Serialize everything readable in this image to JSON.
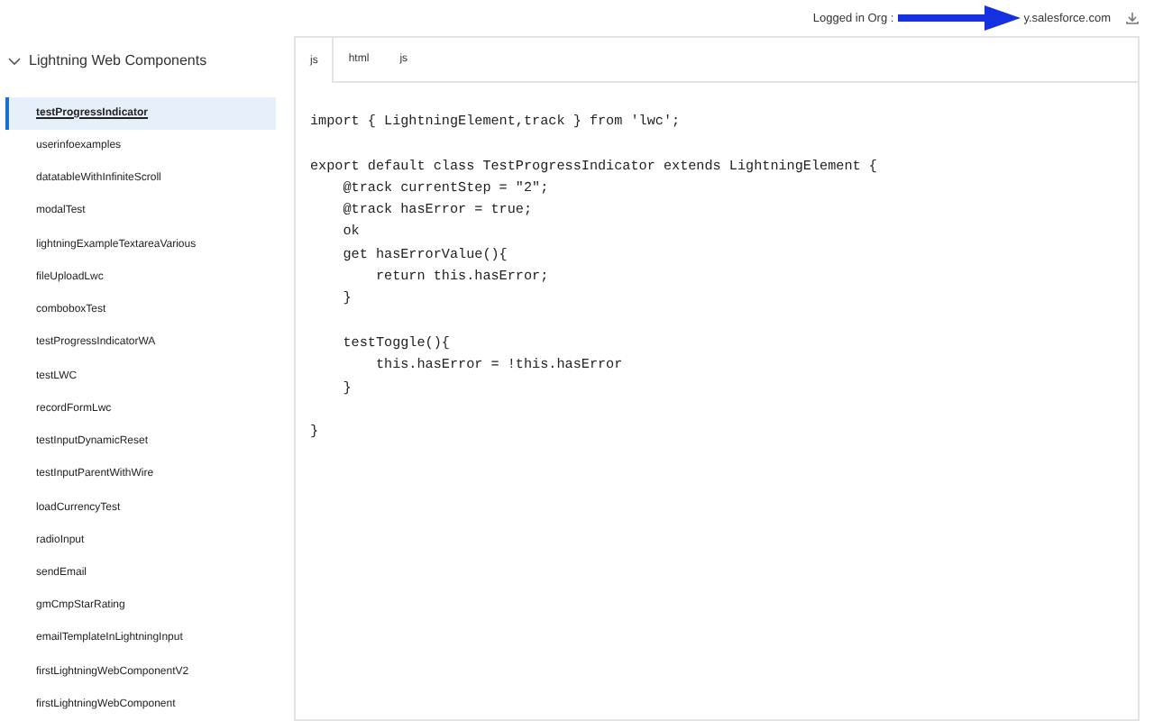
{
  "header": {
    "org_label": "Logged in Org :",
    "org_suffix": "y.salesforce.com"
  },
  "sidebar": {
    "title": "Lightning Web Components",
    "expanded": true,
    "items": [
      {
        "label": "testProgressIndicator",
        "selected": true
      },
      {
        "label": "userinfoexamples",
        "selected": false
      },
      {
        "label": "datatableWithInfiniteScroll",
        "selected": false
      },
      {
        "label": "modalTest",
        "selected": false
      },
      {
        "label": "lightningExampleTextareaVarious",
        "selected": false
      },
      {
        "label": "fileUploadLwc",
        "selected": false
      },
      {
        "label": "comboboxTest",
        "selected": false
      },
      {
        "label": "testProgressIndicatorWA",
        "selected": false
      },
      {
        "label": "testLWC",
        "selected": false
      },
      {
        "label": "recordFormLwc",
        "selected": false
      },
      {
        "label": "testInputDynamicReset",
        "selected": false
      },
      {
        "label": "testInputParentWithWire",
        "selected": false
      },
      {
        "label": "loadCurrencyTest",
        "selected": false
      },
      {
        "label": "radioInput",
        "selected": false
      },
      {
        "label": "sendEmail",
        "selected": false
      },
      {
        "label": "gmCmpStarRating",
        "selected": false
      },
      {
        "label": "emailTemplateInLightningInput",
        "selected": false
      },
      {
        "label": "firstLightningWebComponentV2",
        "selected": false
      },
      {
        "label": "firstLightningWebComponent",
        "selected": false
      }
    ]
  },
  "tabs": [
    {
      "label": "js",
      "selected": true
    },
    {
      "label": "html",
      "selected": false
    },
    {
      "label": "js",
      "selected": false
    }
  ],
  "code_paragraphs": [
    [
      "import { LightningElement,track } from 'lwc';"
    ],
    [
      "export default class TestProgressIndicator extends LightningElement {",
      "    @track currentStep = \"2\";",
      "    @track hasError = true;",
      "    ok",
      "    get hasErrorValue(){",
      "        return this.hasError;",
      "    }"
    ],
    [
      "    testToggle(){",
      "        this.hasError = !this.hasError",
      "    }"
    ],
    [
      "}"
    ]
  ]
}
